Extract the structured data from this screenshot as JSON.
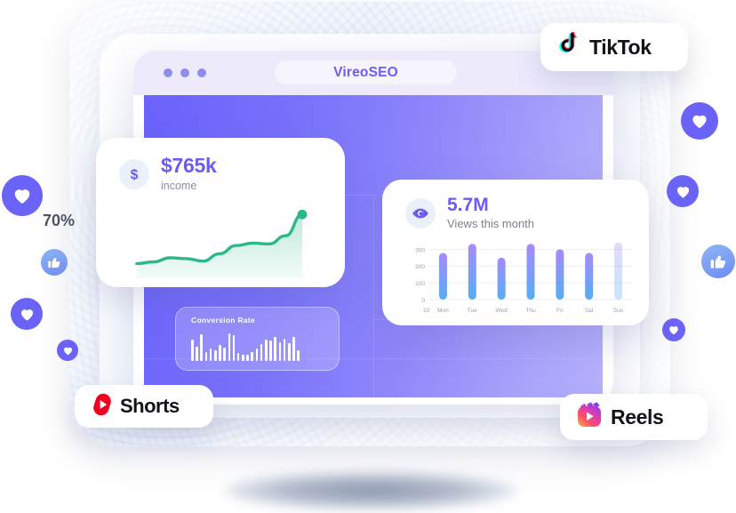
{
  "browser": {
    "window_dots": 3,
    "address_bar_title": "VireoSEO"
  },
  "income_card": {
    "icon": "dollar-icon",
    "value": "$765k",
    "label": "income",
    "percent_label": "70%",
    "accent_color": "#2bb98a",
    "value_color": "#6b5cf6"
  },
  "conversion_card": {
    "title": "Conversion Rate"
  },
  "views_card": {
    "icon": "eye-icon",
    "value": "5.7M",
    "label": "Views this month"
  },
  "badges": [
    {
      "name": "tiktok",
      "label": "TikTok"
    },
    {
      "name": "shorts",
      "label": "Shorts"
    },
    {
      "name": "reels",
      "label": "Reels"
    }
  ],
  "chart_data": [
    {
      "type": "bar",
      "title": "Views this month",
      "categories": [
        "Mon",
        "Tue",
        "Wed",
        "Thu",
        "Fri",
        "Sat",
        "Sun"
      ],
      "values": [
        278,
        332,
        250,
        332,
        300,
        278,
        340
      ],
      "yticks": [
        0,
        100,
        200,
        300
      ],
      "ylim": [
        0,
        360
      ],
      "xlabel": "",
      "ylabel": "",
      "corner_tick": "10",
      "grid": true,
      "legend": "none",
      "bar_gradient_top": "#a78bfa",
      "bar_gradient_bottom": "#55aef0",
      "last_bar_faded": true
    },
    {
      "type": "area",
      "title": "income",
      "value_label": "$765k",
      "annotation": "70%",
      "x": [
        0,
        1,
        2,
        3,
        4,
        5,
        6,
        7,
        8,
        9,
        10
      ],
      "y": [
        18,
        20,
        25,
        24,
        21,
        30,
        40,
        43,
        42,
        52,
        78
      ],
      "ylim": [
        0,
        100
      ],
      "line_color": "#2bb98a",
      "fill_top": "#9adcc4",
      "fill_bottom": "#eafaf3",
      "end_point": true,
      "grid": false
    },
    {
      "type": "bar",
      "title": "Conversion Rate",
      "categories": [
        "1",
        "2",
        "3",
        "4",
        "5",
        "6",
        "7",
        "8",
        "9",
        "10",
        "11",
        "12",
        "13",
        "14",
        "15",
        "16",
        "17",
        "18",
        "19",
        "20",
        "21",
        "22",
        "23",
        "24"
      ],
      "values": [
        72,
        46,
        88,
        30,
        40,
        34,
        52,
        44,
        92,
        86,
        26,
        20,
        22,
        30,
        40,
        55,
        72,
        68,
        80,
        62,
        74,
        58,
        80,
        36
      ],
      "ylim": [
        0,
        100
      ],
      "grid": false,
      "legend": "none",
      "bar_color": "#ffffff"
    }
  ]
}
